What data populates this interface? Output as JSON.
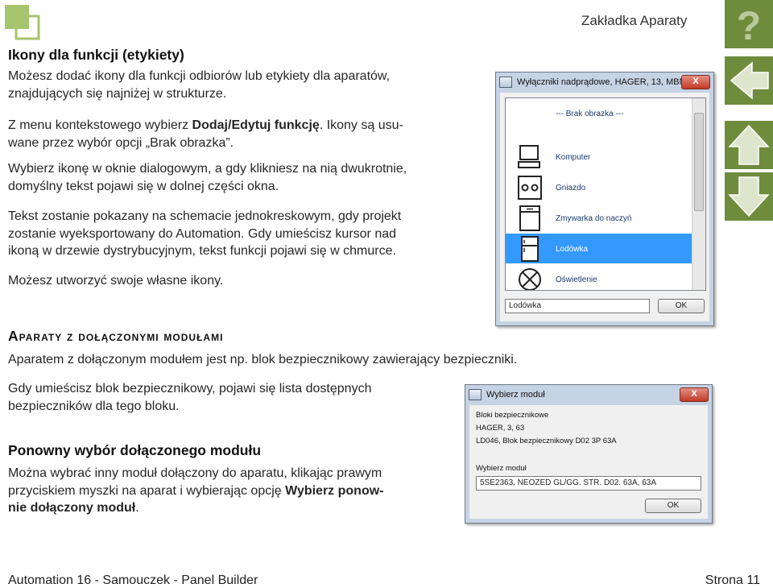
{
  "header": {
    "section_title": "Zakładka Aparaty",
    "help_glyph": "?"
  },
  "nav_icons": [
    "help-icon",
    "back-arrow-icon",
    "up-arrow-icon",
    "down-arrow-icon"
  ],
  "colors": {
    "accent_green": "#6f8b3c",
    "logo_green": "#a7c46e",
    "selection_blue": "#3399ff"
  },
  "section1": {
    "heading": "Ikony dla funkcji (etykiety)",
    "p1": [
      "Możesz dodać ikony dla funkcji odbiorów lub etykiety dla aparatów,",
      "znajdujących się najniżej w strukturze."
    ],
    "p2_line1_a": "Z menu kontekstowego wybierz ",
    "p2_line1_bold": "Dodaj/Edytuj funkcję",
    "p2_line1_b": ". Ikony są usu-",
    "p2_line2": "wane przez wybór opcji „Brak obrazka”.",
    "p3": [
      "Wybierz ikonę w oknie dialogowym, a gdy klikniesz na nią dwukrotnie,",
      "domyślny tekst pojawi się w dolnej części okna."
    ],
    "p4": [
      "Tekst zostanie pokazany na schemacie jednokreskowym, gdy projekt",
      "zostanie wyeksportowany do Automation. Gdy umieścisz kursor nad",
      "ikoną w drzewie dystrybucyjnym, tekst funkcji pojawi się w chmurce."
    ],
    "p5": "Możesz utworzyć swoje własne ikony."
  },
  "dialog1": {
    "title": "Wyłączniki nadprądowe, HAGER, 13, MBN...",
    "close_label": "X",
    "items": [
      {
        "label": "--- Brak obrazka ---",
        "icon": "none"
      },
      {
        "label": "Komputer",
        "icon": "computer-icon"
      },
      {
        "label": "Gniazdo",
        "icon": "socket-icon"
      },
      {
        "label": "Zmywarka do naczyń",
        "icon": "dishwasher-icon"
      },
      {
        "label": "Lodówka",
        "icon": "fridge-icon",
        "selected": true
      },
      {
        "label": "Oświetlenie",
        "icon": "lamp-icon"
      }
    ],
    "text_value": "Lodówka",
    "ok_label": "OK"
  },
  "section2": {
    "heading": "Aparaty z dołączonymi modułami",
    "p1": "Aparatem z dołączonym modułem jest np. blok bezpiecznikowy zawierający bezpieczniki.",
    "p2": [
      "Gdy umieścisz blok bezpiecznikowy, pojawi się lista dostępnych",
      "bezpieczników dla tego bloku."
    ]
  },
  "dialog2": {
    "title": "Wybierz moduł",
    "close_label": "X",
    "group_label": "Bloki bezpiecznikowe",
    "line1": "HAGER, 3, 63",
    "line2": "LD046, Blok bezpiecznikowy D02 3P 63A",
    "select_label": "Wybierz moduł",
    "select_value": "5SE2363, NEOZED GL/GG. STR. D02. 63A, 63A",
    "ok_label": "OK"
  },
  "section3": {
    "heading": "Ponowny wybór dołączonego modułu",
    "line1": "Można wybrać inny moduł dołączony do aparatu, klikając prawym",
    "line2_a": "przyciskiem myszki na aparat i wybierając opcję ",
    "line2_bold": "Wybierz ponow-",
    "line3_bold": "nie dołączony moduł",
    "line3_b": "."
  },
  "footer": {
    "left": "Automation 16 - Samouczek - Panel Builder",
    "right": "Strona 11"
  }
}
